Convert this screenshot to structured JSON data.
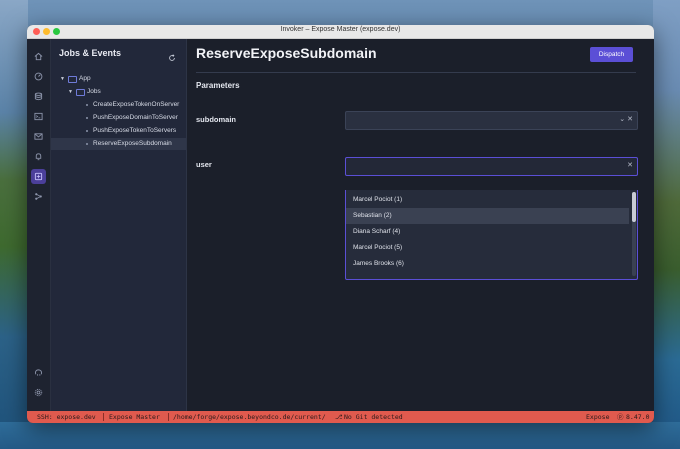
{
  "window": {
    "title": "Invoker – Expose Master (expose.dev)"
  },
  "rail": {
    "icons": [
      "home-icon",
      "gauge-icon",
      "database-icon",
      "terminal-icon",
      "mail-icon",
      "bell-icon",
      "jobs-icon",
      "flow-icon",
      "elephant-icon",
      "settings-icon"
    ]
  },
  "tree": {
    "title": "Jobs & Events",
    "items": [
      {
        "label": "App"
      },
      {
        "label": "Jobs"
      },
      {
        "label": "CreateExposeTokenOnServer"
      },
      {
        "label": "PushExposeDomainToServer"
      },
      {
        "label": "PushExposeTokenToServers"
      },
      {
        "label": "ReserveExposeSubdomain"
      }
    ]
  },
  "main": {
    "title": "ReserveExposeSubdomain",
    "dispatch_label": "Dispatch",
    "section_title": "Parameters",
    "fields": [
      {
        "label": "subdomain",
        "value": ""
      },
      {
        "label": "user",
        "value": ""
      }
    ],
    "options": [
      "Marcel Pociot (1)",
      "Sebastian (2)",
      "Diana Scharf (4)",
      "Marcel Pociot (5)",
      "James Brooks (6)"
    ],
    "highlighted_option": 1
  },
  "status": {
    "ssh": "SSH: expose.dev",
    "project": "Expose Master",
    "path": "/home/forge/expose.beyondco.de/current/",
    "git": "No Git detected",
    "app": "Expose",
    "version": "8.47.0"
  },
  "colors": {
    "accent": "#5b4fd6",
    "statusbar": "#e05a4e",
    "background": "#1b1f2a"
  }
}
